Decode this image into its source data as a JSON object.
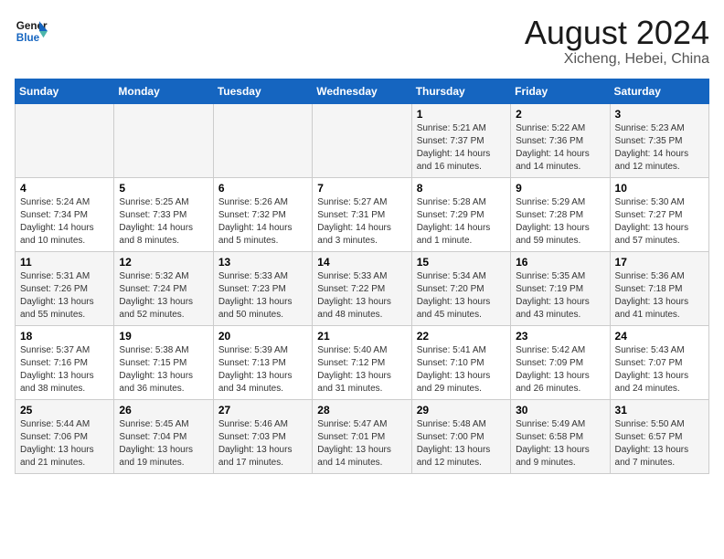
{
  "header": {
    "logo_line1": "General",
    "logo_line2": "Blue",
    "title": "August 2024",
    "subtitle": "Xicheng, Hebei, China"
  },
  "days_of_week": [
    "Sunday",
    "Monday",
    "Tuesday",
    "Wednesday",
    "Thursday",
    "Friday",
    "Saturday"
  ],
  "weeks": [
    [
      {
        "day": "",
        "info": ""
      },
      {
        "day": "",
        "info": ""
      },
      {
        "day": "",
        "info": ""
      },
      {
        "day": "",
        "info": ""
      },
      {
        "day": "1",
        "info": "Sunrise: 5:21 AM\nSunset: 7:37 PM\nDaylight: 14 hours\nand 16 minutes."
      },
      {
        "day": "2",
        "info": "Sunrise: 5:22 AM\nSunset: 7:36 PM\nDaylight: 14 hours\nand 14 minutes."
      },
      {
        "day": "3",
        "info": "Sunrise: 5:23 AM\nSunset: 7:35 PM\nDaylight: 14 hours\nand 12 minutes."
      }
    ],
    [
      {
        "day": "4",
        "info": "Sunrise: 5:24 AM\nSunset: 7:34 PM\nDaylight: 14 hours\nand 10 minutes."
      },
      {
        "day": "5",
        "info": "Sunrise: 5:25 AM\nSunset: 7:33 PM\nDaylight: 14 hours\nand 8 minutes."
      },
      {
        "day": "6",
        "info": "Sunrise: 5:26 AM\nSunset: 7:32 PM\nDaylight: 14 hours\nand 5 minutes."
      },
      {
        "day": "7",
        "info": "Sunrise: 5:27 AM\nSunset: 7:31 PM\nDaylight: 14 hours\nand 3 minutes."
      },
      {
        "day": "8",
        "info": "Sunrise: 5:28 AM\nSunset: 7:29 PM\nDaylight: 14 hours\nand 1 minute."
      },
      {
        "day": "9",
        "info": "Sunrise: 5:29 AM\nSunset: 7:28 PM\nDaylight: 13 hours\nand 59 minutes."
      },
      {
        "day": "10",
        "info": "Sunrise: 5:30 AM\nSunset: 7:27 PM\nDaylight: 13 hours\nand 57 minutes."
      }
    ],
    [
      {
        "day": "11",
        "info": "Sunrise: 5:31 AM\nSunset: 7:26 PM\nDaylight: 13 hours\nand 55 minutes."
      },
      {
        "day": "12",
        "info": "Sunrise: 5:32 AM\nSunset: 7:24 PM\nDaylight: 13 hours\nand 52 minutes."
      },
      {
        "day": "13",
        "info": "Sunrise: 5:33 AM\nSunset: 7:23 PM\nDaylight: 13 hours\nand 50 minutes."
      },
      {
        "day": "14",
        "info": "Sunrise: 5:33 AM\nSunset: 7:22 PM\nDaylight: 13 hours\nand 48 minutes."
      },
      {
        "day": "15",
        "info": "Sunrise: 5:34 AM\nSunset: 7:20 PM\nDaylight: 13 hours\nand 45 minutes."
      },
      {
        "day": "16",
        "info": "Sunrise: 5:35 AM\nSunset: 7:19 PM\nDaylight: 13 hours\nand 43 minutes."
      },
      {
        "day": "17",
        "info": "Sunrise: 5:36 AM\nSunset: 7:18 PM\nDaylight: 13 hours\nand 41 minutes."
      }
    ],
    [
      {
        "day": "18",
        "info": "Sunrise: 5:37 AM\nSunset: 7:16 PM\nDaylight: 13 hours\nand 38 minutes."
      },
      {
        "day": "19",
        "info": "Sunrise: 5:38 AM\nSunset: 7:15 PM\nDaylight: 13 hours\nand 36 minutes."
      },
      {
        "day": "20",
        "info": "Sunrise: 5:39 AM\nSunset: 7:13 PM\nDaylight: 13 hours\nand 34 minutes."
      },
      {
        "day": "21",
        "info": "Sunrise: 5:40 AM\nSunset: 7:12 PM\nDaylight: 13 hours\nand 31 minutes."
      },
      {
        "day": "22",
        "info": "Sunrise: 5:41 AM\nSunset: 7:10 PM\nDaylight: 13 hours\nand 29 minutes."
      },
      {
        "day": "23",
        "info": "Sunrise: 5:42 AM\nSunset: 7:09 PM\nDaylight: 13 hours\nand 26 minutes."
      },
      {
        "day": "24",
        "info": "Sunrise: 5:43 AM\nSunset: 7:07 PM\nDaylight: 13 hours\nand 24 minutes."
      }
    ],
    [
      {
        "day": "25",
        "info": "Sunrise: 5:44 AM\nSunset: 7:06 PM\nDaylight: 13 hours\nand 21 minutes."
      },
      {
        "day": "26",
        "info": "Sunrise: 5:45 AM\nSunset: 7:04 PM\nDaylight: 13 hours\nand 19 minutes."
      },
      {
        "day": "27",
        "info": "Sunrise: 5:46 AM\nSunset: 7:03 PM\nDaylight: 13 hours\nand 17 minutes."
      },
      {
        "day": "28",
        "info": "Sunrise: 5:47 AM\nSunset: 7:01 PM\nDaylight: 13 hours\nand 14 minutes."
      },
      {
        "day": "29",
        "info": "Sunrise: 5:48 AM\nSunset: 7:00 PM\nDaylight: 13 hours\nand 12 minutes."
      },
      {
        "day": "30",
        "info": "Sunrise: 5:49 AM\nSunset: 6:58 PM\nDaylight: 13 hours\nand 9 minutes."
      },
      {
        "day": "31",
        "info": "Sunrise: 5:50 AM\nSunset: 6:57 PM\nDaylight: 13 hours\nand 7 minutes."
      }
    ]
  ]
}
